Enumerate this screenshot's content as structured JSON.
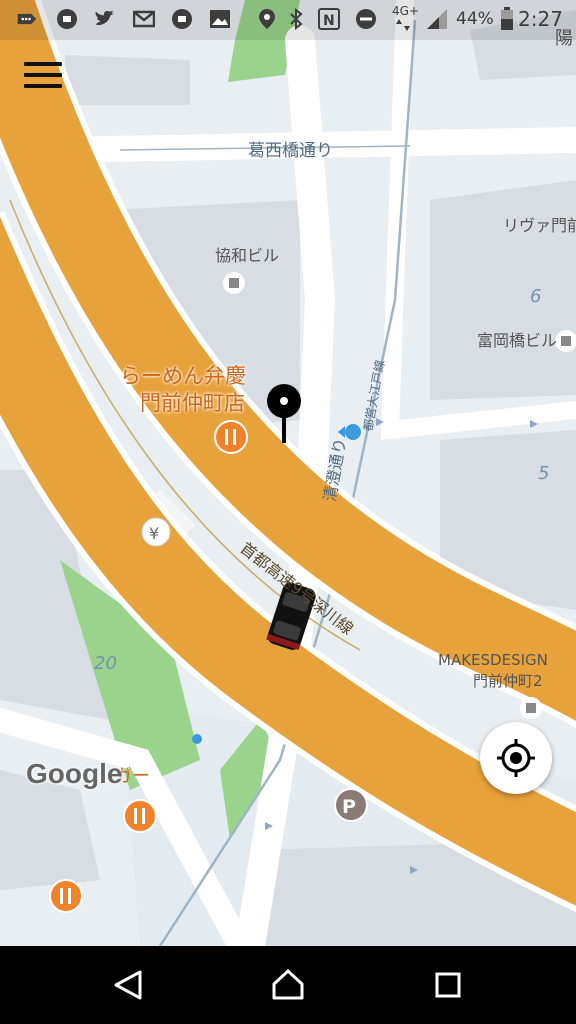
{
  "status_bar": {
    "network": "4G+",
    "battery": "44%",
    "time": "2:27",
    "icons": [
      "notification-icon",
      "app-icon",
      "twitter-icon",
      "gmail-icon",
      "app-icon",
      "gallery-icon",
      "location-icon",
      "bluetooth-icon",
      "nfc-icon",
      "do-not-disturb-icon",
      "signal-icon",
      "battery-icon"
    ]
  },
  "map": {
    "streets": {
      "kasai": "葛西橋通り",
      "kiyosumi": "清澄通り",
      "expressway": "首都高速9号深川線",
      "oedo": "都営大江戸線"
    },
    "places": {
      "kyowa": "協和ビル",
      "ramen_1": "らーめん弁慶",
      "ramen_2": "門前仲町店",
      "river": "リヴァ門前",
      "tomioka": "富岡橋ビル",
      "makes_1": "MAKESDESIGN",
      "makes_2": "門前仲町2",
      "burger_partial": "ガー",
      "top_right_partial": "陽"
    },
    "block_numbers": [
      "6",
      "5",
      "20"
    ]
  },
  "branding": {
    "logo": "Google"
  },
  "colors": {
    "expressway": "#e8a23b",
    "road": "#ffffff",
    "park": "#9ad48c",
    "restaurant": "#f0822a",
    "transit": "#3b9be0"
  }
}
